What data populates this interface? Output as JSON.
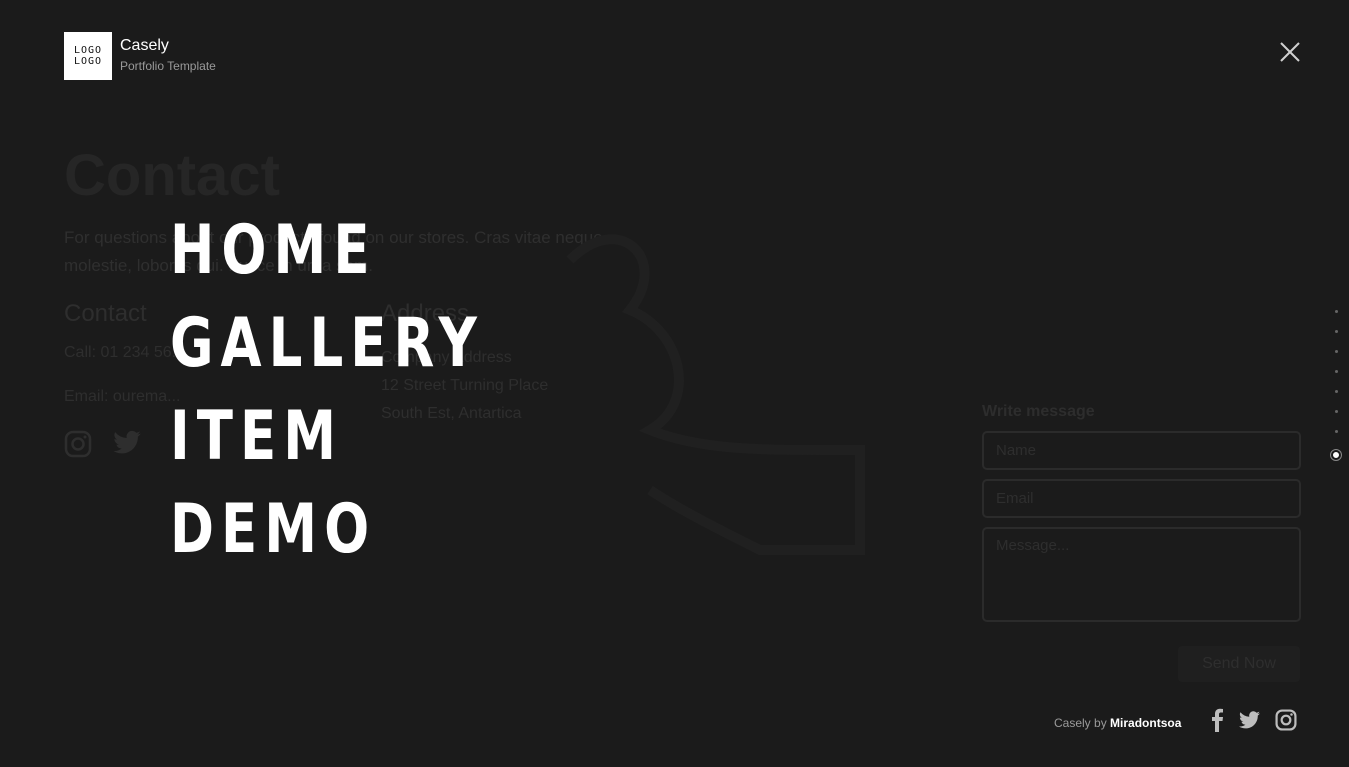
{
  "header": {
    "logo_line1": "LOGO",
    "logo_line2": "LOGO",
    "brand_name": "Casely",
    "brand_tagline": "Portfolio Template"
  },
  "menu": {
    "items": [
      "HOME",
      "GALLERY",
      "ITEM",
      "DEMO"
    ]
  },
  "background": {
    "title": "Contact",
    "intro": "For questions about our products found on our stores. Cras vitae neque molestie, lobortis dui. Fusce in urna sem.",
    "contact_heading": "Contact",
    "call": "Call: 01 234 56...",
    "email": "Email: ourema...",
    "address_heading": "Address",
    "address_line1": "Company Address",
    "address_line2": "12 Street Turning Place",
    "address_line3": "South Est, Antartica"
  },
  "form": {
    "title": "Write message",
    "name_placeholder": "Name",
    "email_placeholder": "Email",
    "message_placeholder": "Message...",
    "send_label": "Send Now"
  },
  "section_dots": {
    "count": 8,
    "active_index": 7
  },
  "footer": {
    "credit_prefix": "Casely by",
    "credit_author": "Miradontsoa"
  },
  "icons": {
    "close": "close-icon",
    "social": [
      "facebook-icon",
      "twitter-icon",
      "instagram-icon"
    ]
  },
  "colors": {
    "background": "#1b1b1b",
    "menu_text": "#ffffff",
    "muted_text": "#2e2e2e"
  }
}
